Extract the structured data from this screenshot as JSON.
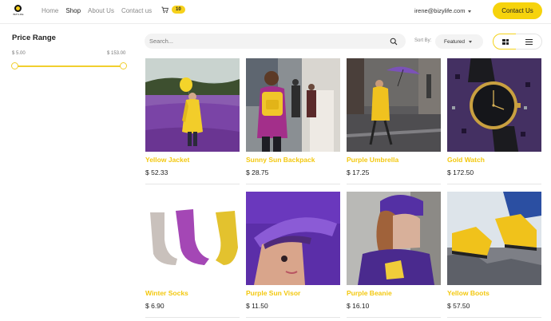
{
  "header": {
    "logo_text": "BIZYLIFE",
    "nav": [
      "Home",
      "Shop",
      "About Us",
      "Contact us"
    ],
    "nav_active": "Shop",
    "cart_count": "10",
    "user_email": "irene@bizylife.com",
    "contact_button": "Contact Us"
  },
  "sidebar": {
    "title": "Price Range",
    "min_label": "$ 5.00",
    "max_label": "$ 153.00"
  },
  "toolbar": {
    "search_placeholder": "Search...",
    "sort_label": "Sort By:",
    "sort_value": "Featured"
  },
  "products": [
    {
      "name": "Yellow Jacket",
      "price": "$ 52.33"
    },
    {
      "name": "Sunny Sun Backpack",
      "price": "$ 28.75"
    },
    {
      "name": "Purple Umbrella",
      "price": "$ 17.25"
    },
    {
      "name": "Gold Watch",
      "price": "$ 172.50"
    },
    {
      "name": "Winter Socks",
      "price": "$ 6.90"
    },
    {
      "name": "Purple Sun Visor",
      "price": "$ 11.50"
    },
    {
      "name": "Purple Beanie",
      "price": "$ 16.10"
    },
    {
      "name": "Yellow Boots",
      "price": "$ 57.50"
    }
  ],
  "colors": {
    "accent": "#f6d30c",
    "product_name": "#f3c80f"
  }
}
